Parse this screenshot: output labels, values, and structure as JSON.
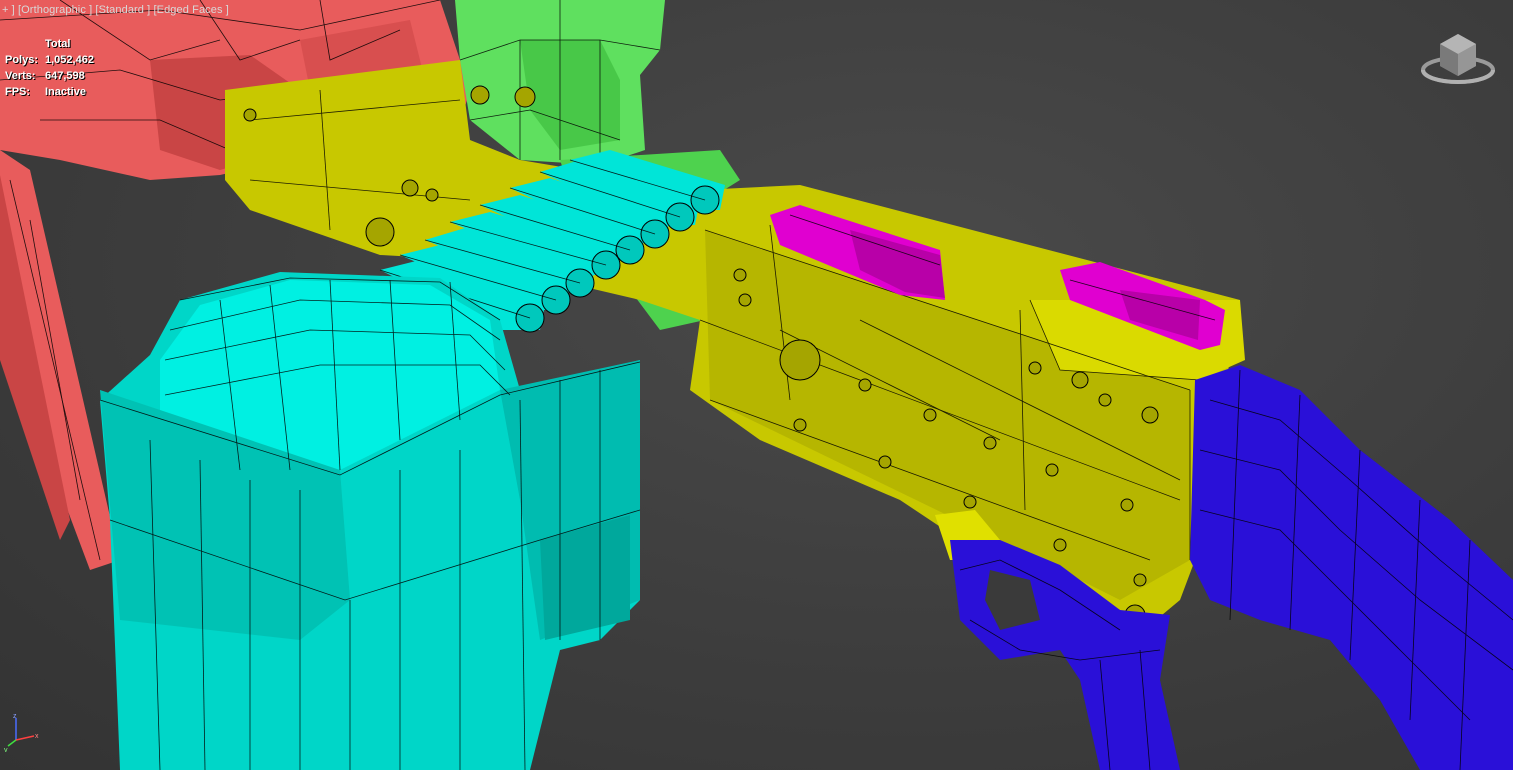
{
  "viewport": {
    "label_parts": [
      "+ ]",
      "[Orthographic ]",
      "[Standard ]",
      "[Edged Faces ]"
    ],
    "stats": {
      "header": "Total",
      "polys_label": "Polys:",
      "polys_value": "1,052,462",
      "verts_label": "Verts:",
      "verts_value": "647,598",
      "fps_label": "FPS:",
      "fps_value": "Inactive"
    },
    "axes": {
      "x": "x",
      "y": "y",
      "z": "z"
    }
  },
  "colors": {
    "background": "#404040",
    "red_part": "#e85a5a",
    "green_part": "#5fe05f",
    "yellow_part": "#c8c800",
    "cyan_part": "#00e5d8",
    "magenta_part": "#e000d0",
    "blue_part": "#2a10d8"
  }
}
